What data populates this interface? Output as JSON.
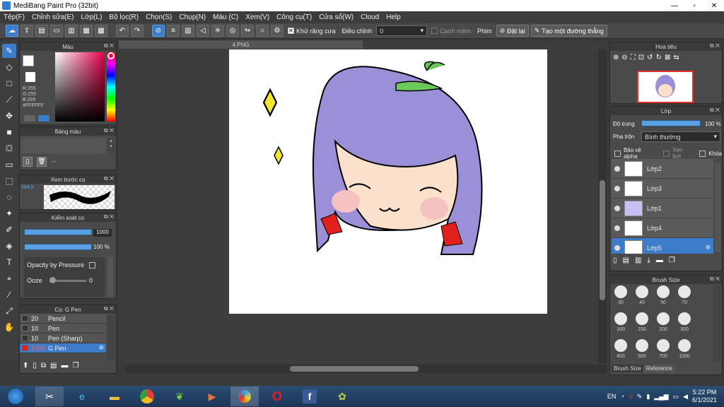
{
  "window": {
    "title": "MediBang Paint Pro (32bit)",
    "min": "—",
    "max": "▫",
    "close": "✕"
  },
  "menu": [
    "Tệp(F)",
    "Chỉnh sửa(E)",
    "Lớp(L)",
    "Bộ lọc(R)",
    "Chọn(S)",
    "Chụp(N)",
    "Màu (C)",
    "Xem(V)",
    "Công cụ(T)",
    "Cửa sổ(W)",
    "Cloud",
    "Help"
  ],
  "toolbar": {
    "antialias_label": "Khử răng cưa",
    "adjust_label": "Điều chỉnh",
    "adjust_value": "0",
    "edge_label": "Cạnh mềm",
    "prim_label": "Phim",
    "stop_label": "Đặt lại",
    "straight_label": "Tạo một đường thẳng"
  },
  "color_panel": {
    "title": "Màu",
    "r": "R:255",
    "g": "G:255",
    "b": "B:255",
    "hex": "#FFFFFF",
    "foreground": "#ffffff",
    "background": "#ff0000"
  },
  "palette_panel": {
    "title": "Bảng màu",
    "dash": "---"
  },
  "brush_preview": {
    "title": "Xem trước cọ",
    "size": "264.5"
  },
  "brush_control": {
    "title": "Kiểm soát cọ",
    "size_value": "1000",
    "opacity_value": "100 %",
    "opacity_pressure_label": "Opacity by Pressure",
    "ooze_label": "Ooze",
    "ooze_value": "0"
  },
  "brush_list": {
    "title": "Cọ: G Pen",
    "items": [
      {
        "size": "20",
        "name": "Pencil"
      },
      {
        "size": "10",
        "name": "Pen"
      },
      {
        "size": "10",
        "name": "Pen (Sharp)"
      },
      {
        "size": "1000",
        "name": "G Pen"
      }
    ]
  },
  "canvas": {
    "tab_label": "4.PNG"
  },
  "navigator": {
    "title": "Hoa tiêu"
  },
  "layers": {
    "title": "Lớp",
    "opacity_label": "Độ trong",
    "opacity_value": "100 %",
    "opacity_level": 1.0,
    "blend_label": "Pha trộn",
    "blend_value": "Bình thường",
    "protect_alpha": "Bảo vệ alpha",
    "clipping": "Xén bớt",
    "lock": "Khóa",
    "items": [
      {
        "name": "Lớp2"
      },
      {
        "name": "Lớp3"
      },
      {
        "name": "Lớp1"
      },
      {
        "name": "Lớp4"
      },
      {
        "name": "Lớp5"
      }
    ]
  },
  "brush_size": {
    "title": "Brush Size",
    "sizes": [
      "30",
      "40",
      "50",
      "70",
      "100",
      "150",
      "200",
      "300",
      "400",
      "500",
      "700",
      "1000"
    ],
    "tabs": [
      "Brush Size",
      "Reference"
    ]
  },
  "taskbar": {
    "lang": "EN",
    "time": "5:22 PM",
    "date": "6/1/2021"
  }
}
